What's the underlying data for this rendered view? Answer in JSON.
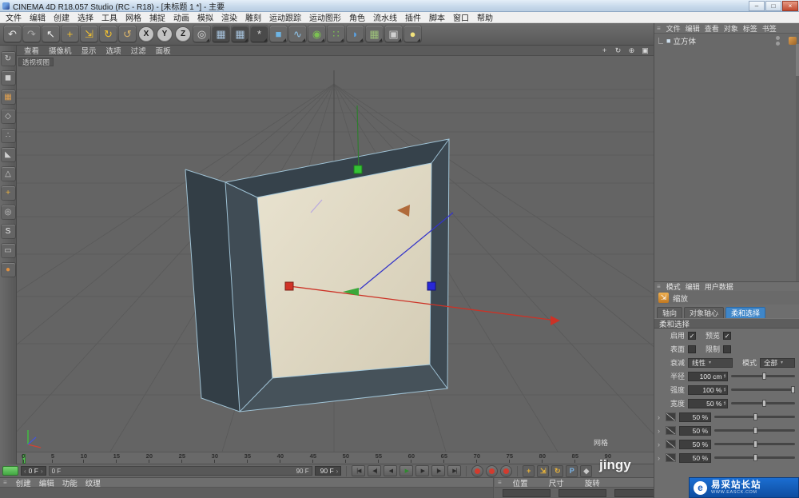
{
  "window": {
    "title": "CINEMA 4D R18.057 Studio (RC - R18) - [未标题 1 *] - 主要",
    "controls": {
      "minimize": "–",
      "maximize": "□",
      "close": "×"
    }
  },
  "menu_bar": [
    "文件",
    "编辑",
    "创建",
    "选择",
    "工具",
    "网格",
    "捕捉",
    "动画",
    "模拟",
    "渲染",
    "雕刻",
    "运动跟踪",
    "运动图形",
    "角色",
    "流水线",
    "插件",
    "脚本",
    "窗口",
    "帮助"
  ],
  "glyphs": {
    "grip": "≡",
    "caret": "▾",
    "spin_up": "▴",
    "spin_down": "▾",
    "prev": "‹",
    "next": "›",
    "check": "✓"
  },
  "toolbar_icons": [
    {
      "name": "undo-icon",
      "glyph": "↶",
      "fg": "#e6e6e6"
    },
    {
      "name": "redo-icon",
      "glyph": "↷",
      "fg": "#a8a8a8"
    },
    {
      "name": "live-selection-icon",
      "glyph": "↖",
      "fg": "#f0f0f0"
    },
    {
      "name": "move-tool-icon",
      "glyph": "+",
      "fg": "#f2c12e"
    },
    {
      "name": "scale-tool-icon",
      "glyph": "⇲",
      "fg": "#f2c12e"
    },
    {
      "name": "rotate-tool-icon",
      "glyph": "↻",
      "fg": "#f2c12e"
    },
    {
      "name": "last-tool-icon",
      "glyph": "↺",
      "fg": "#d8b36a"
    },
    {
      "name": "x-axis-button",
      "glyph": "X",
      "fg": "#1c1c1c",
      "bg": "#c2c2c2",
      "shape": "circle"
    },
    {
      "name": "y-axis-button",
      "glyph": "Y",
      "fg": "#1c1c1c",
      "bg": "#c2c2c2",
      "shape": "circle"
    },
    {
      "name": "z-axis-button",
      "glyph": "Z",
      "fg": "#1c1c1c",
      "bg": "#c2c2c2",
      "shape": "circle"
    },
    {
      "name": "coordinate-system-icon",
      "glyph": "◎",
      "fg": "#d8d8d8",
      "dd": true
    },
    {
      "name": "render-view-icon",
      "glyph": "▦",
      "fg": "#a8c4de",
      "bg": "#4a4a4a"
    },
    {
      "name": "render-picture-viewer-icon",
      "glyph": "▦",
      "fg": "#a8c4de",
      "bg": "#4a4a4a",
      "dd": true
    },
    {
      "name": "render-settings-icon",
      "glyph": "*",
      "fg": "#d8d8d8",
      "bg": "#4a4a4a",
      "dd": true
    },
    {
      "name": "cube-primitive-icon",
      "glyph": "■",
      "fg": "#6db4e4",
      "dd": true
    },
    {
      "name": "spline-pen-icon",
      "glyph": "∿",
      "fg": "#8fc3e8",
      "dd": true
    },
    {
      "name": "subdivision-surface-icon",
      "glyph": "◉",
      "fg": "#7cc152",
      "dd": true
    },
    {
      "name": "array-modifier-icon",
      "glyph": "∷",
      "fg": "#7cc152",
      "dd": true
    },
    {
      "name": "deformer-icon",
      "glyph": "◗",
      "fg": "#5aa0e0",
      "dd": true
    },
    {
      "name": "environment-icon",
      "glyph": "▦",
      "fg": "#9cc07a",
      "dd": true
    },
    {
      "name": "camera-icon",
      "glyph": "▣",
      "fg": "#d0d0d0",
      "dd": true
    },
    {
      "name": "light-icon",
      "glyph": "●",
      "fg": "#f2e27c",
      "dd": true
    }
  ],
  "left_toolbar_icons": [
    {
      "name": "make-editable-icon",
      "glyph": "↻",
      "fg": "#cfcfcf"
    },
    {
      "name": "model-mode-icon",
      "glyph": "◼",
      "fg": "#cfcfcf"
    },
    {
      "name": "texture-mode-icon",
      "glyph": "▦",
      "fg": "#e0a050"
    },
    {
      "name": "workplane-mode-icon",
      "glyph": "◇",
      "fg": "#cfcfcf"
    },
    {
      "name": "points-mode-icon",
      "glyph": "∴",
      "fg": "#cfcfcf"
    },
    {
      "name": "edges-mode-icon",
      "glyph": "◣",
      "fg": "#cfcfcf"
    },
    {
      "name": "polygons-mode-icon",
      "glyph": "△",
      "fg": "#cfcfcf"
    },
    {
      "name": "enable-axis-icon",
      "glyph": "+",
      "fg": "#e8b040"
    },
    {
      "name": "solo-mode-icon",
      "glyph": "◎",
      "fg": "#cfcfcf"
    },
    {
      "name": "enable-snap-icon",
      "glyph": "S",
      "fg": "#f0f0f0"
    },
    {
      "name": "workplane-lock-icon",
      "glyph": "▭",
      "fg": "#cfcfcf"
    },
    {
      "name": "sculpt-layer-icon",
      "glyph": "●",
      "fg": "#e09040"
    }
  ],
  "viewport": {
    "menu": [
      "查看",
      "摄像机",
      "显示",
      "选项",
      "过滤",
      "面板"
    ],
    "view_label": "透视视图",
    "hud_grid_label": "网格",
    "nav_icons": [
      {
        "name": "pan-view-icon",
        "glyph": "+"
      },
      {
        "name": "orbit-view-icon",
        "glyph": "↻"
      },
      {
        "name": "zoom-view-icon",
        "glyph": "⊕"
      },
      {
        "name": "toggle-layout-icon",
        "glyph": "▣"
      }
    ]
  },
  "object_manager": {
    "menu": [
      "文件",
      "编辑",
      "查看",
      "对象",
      "标签",
      "书签"
    ],
    "objects": [
      {
        "name": "立方体",
        "icon": "■"
      }
    ]
  },
  "attribute_manager": {
    "menu": [
      "模式",
      "编辑",
      "用户数据"
    ],
    "tool_title": "缩放",
    "tool_icon": "⇲",
    "tabs": [
      {
        "label": "轴向",
        "cls": ""
      },
      {
        "label": "对象轴心",
        "cls": ""
      },
      {
        "label": "柔和选择",
        "cls": "active"
      }
    ],
    "section_title": "柔和选择",
    "rows": {
      "enable_label": "启用",
      "preview_label": "预览",
      "surface_label": "表面",
      "limit_label": "限制",
      "falloff_label": "衰减",
      "falloff_value": "线性",
      "mode_label": "模式",
      "mode_value": "全部",
      "radius_label": "半径",
      "radius_value": "100 cm",
      "strength_label": "强度",
      "strength_value": "100 %",
      "width_label": "宽度",
      "width_value": "50 %"
    },
    "curve_rows": [
      "50 %",
      "50 %",
      "50 %",
      "50 %"
    ]
  },
  "timeline": {
    "ticks": [
      "0",
      "5",
      "10",
      "15",
      "20",
      "25",
      "30",
      "35",
      "40",
      "45",
      "50",
      "55",
      "60",
      "65",
      "70",
      "75",
      "80",
      "85",
      "90"
    ],
    "current_frame": "0 F",
    "range_start": "0 F",
    "range_end": "90 F",
    "end_frame": "90 F",
    "transport": [
      {
        "name": "goto-start-button",
        "glyph": "|◀"
      },
      {
        "name": "prev-key-button",
        "glyph": "◀|"
      },
      {
        "name": "prev-frame-button",
        "glyph": "◀"
      },
      {
        "name": "play-button",
        "glyph": "▶",
        "accent": "#2f8a2f"
      },
      {
        "name": "next-frame-button",
        "glyph": "▶"
      },
      {
        "name": "next-key-button",
        "glyph": "|▶"
      },
      {
        "name": "goto-end-button",
        "glyph": "▶|"
      }
    ],
    "record_buttons": [
      {
        "name": "record-keyframe-button",
        "fg": "#d23b2e"
      },
      {
        "name": "autokey-button",
        "fg": "#d23b2e"
      },
      {
        "name": "keyframe-selection-button",
        "fg": "#d23b2e"
      }
    ],
    "key_toggles": [
      {
        "name": "record-position-toggle",
        "glyph": "+",
        "fg": "#e8b33a"
      },
      {
        "name": "record-scale-toggle",
        "glyph": "⇲",
        "fg": "#e8b33a"
      },
      {
        "name": "record-rotation-toggle",
        "glyph": "↻",
        "fg": "#e8b33a"
      },
      {
        "name": "record-parameter-toggle",
        "glyph": "P",
        "fg": "#7ab4e8"
      },
      {
        "name": "record-pla-toggle",
        "glyph": "◆",
        "fg": "#c9c9c9"
      }
    ]
  },
  "material_manager": {
    "menu": [
      "创建",
      "编辑",
      "功能",
      "纹理"
    ]
  },
  "coordinate_manager": {
    "headers": [
      "位置",
      "尺寸",
      "旋转"
    ]
  },
  "watermark": "jingy",
  "site_badge": {
    "mark": "e",
    "title": "易采站长站",
    "subtitle": "WWW.EASCK.COM"
  },
  "colors": {
    "tab_active": "#3f86c8",
    "scrubber_green": "#58c156",
    "axis_x": "#cc3226",
    "axis_y": "#35c235",
    "axis_z": "#2828d8",
    "frame_face": "#3d4952",
    "frame_inner": "#ddd6c0"
  }
}
